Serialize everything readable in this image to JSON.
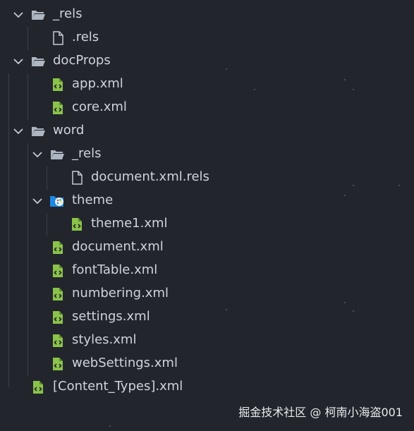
{
  "tree": [
    {
      "label": "_rels",
      "icon": "folder-open-icon",
      "expanded": true
    },
    {
      "label": ".rels",
      "icon": "file-icon"
    },
    {
      "label": "docProps",
      "icon": "folder-open-icon",
      "expanded": true
    },
    {
      "label": "app.xml",
      "icon": "xml-file-icon"
    },
    {
      "label": "core.xml",
      "icon": "xml-file-icon"
    },
    {
      "label": "word",
      "icon": "folder-open-icon",
      "expanded": true
    },
    {
      "label": "_rels",
      "icon": "folder-open-icon",
      "expanded": true
    },
    {
      "label": "document.xml.rels",
      "icon": "file-icon"
    },
    {
      "label": "theme",
      "icon": "theme-folder-icon",
      "expanded": true
    },
    {
      "label": "theme1.xml",
      "icon": "xml-file-icon"
    },
    {
      "label": "document.xml",
      "icon": "xml-file-icon"
    },
    {
      "label": "fontTable.xml",
      "icon": "xml-file-icon"
    },
    {
      "label": "numbering.xml",
      "icon": "xml-file-icon"
    },
    {
      "label": "settings.xml",
      "icon": "xml-file-icon"
    },
    {
      "label": "styles.xml",
      "icon": "xml-file-icon"
    },
    {
      "label": "webSettings.xml",
      "icon": "xml-file-icon"
    },
    {
      "label": "[Content_Types].xml",
      "icon": "xml-file-icon"
    }
  ],
  "watermark": "掘金技术社区 @ 柯南小海盗001",
  "colors": {
    "background": "#22262c",
    "text": "#cfd3da",
    "xml_icon": "#8bc34a",
    "folder_icon": "#aeb6c2",
    "theme_icon": "#42a5f5"
  }
}
